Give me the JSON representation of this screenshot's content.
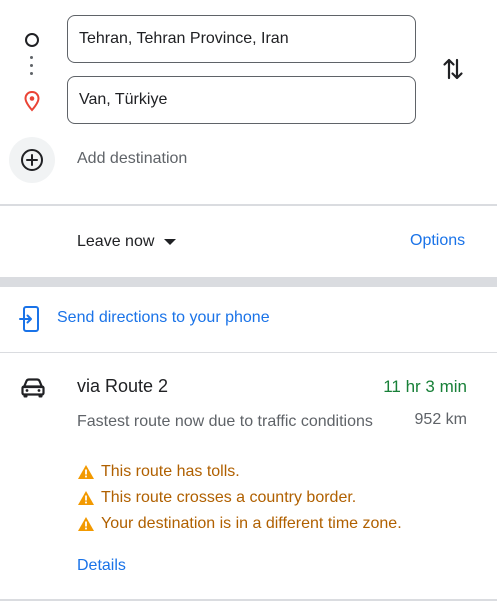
{
  "search": {
    "origin_value": "Tehran, Tehran Province, Iran",
    "destination_value": "Van, Türkiye",
    "add_destination_label": "Add destination",
    "icons": {
      "origin": "origin-circle-icon",
      "destination": "destination-pin-icon",
      "swap": "swap-icon",
      "add": "add-circle-icon"
    }
  },
  "depart": {
    "leave_label": "Leave now",
    "options_label": "Options"
  },
  "send": {
    "label": "Send directions to your phone",
    "icon": "send-to-phone-icon"
  },
  "route": {
    "mode_icon": "car-icon",
    "title": "via Route 2",
    "duration": "11 hr 3 min",
    "description": "Fastest route now due to traffic conditions",
    "distance": "952 km",
    "warnings": [
      "This route has tolls.",
      "This route crosses a country border.",
      "Your destination is in a different time zone."
    ],
    "details_label": "Details"
  },
  "colors": {
    "accent_blue": "#1a73e8",
    "duration_green": "#188038",
    "warning_orange": "#f29900",
    "pin_red": "#ea4335"
  }
}
